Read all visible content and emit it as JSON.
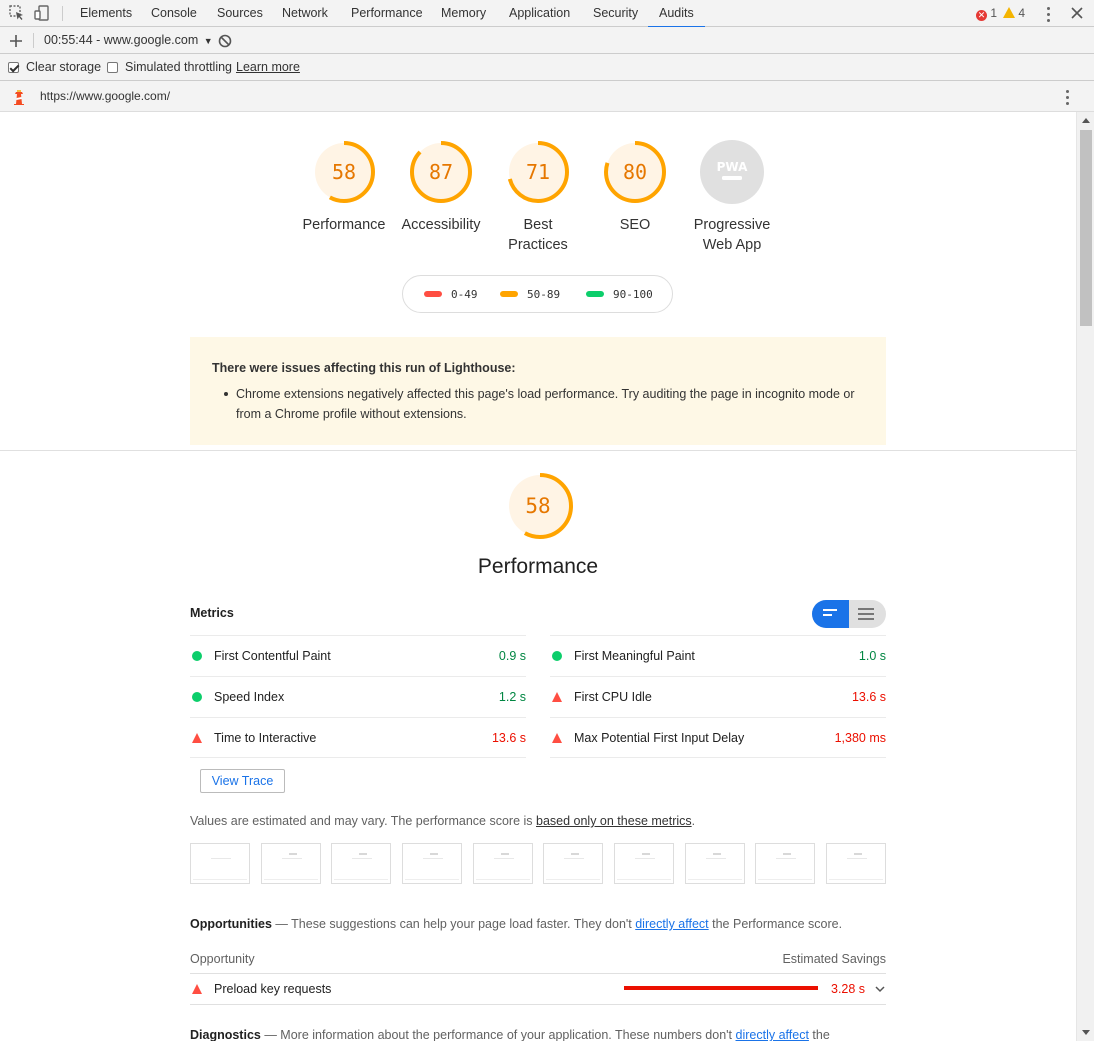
{
  "devtools": {
    "tabs": [
      "Elements",
      "Console",
      "Sources",
      "Network",
      "Performance",
      "Memory",
      "Application",
      "Security",
      "Audits"
    ],
    "active_tab": "Audits",
    "error_count": "1",
    "warning_count": "4"
  },
  "toolbar": {
    "report_selector": "00:55:44 - www.google.com",
    "clear_storage_label": "Clear storage",
    "clear_storage_checked": true,
    "simulated_throttling_label": "Simulated throttling",
    "simulated_throttling_checked": false,
    "learn_more_label": "Learn more"
  },
  "url": "https://www.google.com/",
  "scores": [
    {
      "label_line1": "Performance",
      "label_line2": "",
      "value": "58",
      "fraction": 0.58
    },
    {
      "label_line1": "Accessibility",
      "label_line2": "",
      "value": "87",
      "fraction": 0.87
    },
    {
      "label_line1": "Best",
      "label_line2": "Practices",
      "value": "71",
      "fraction": 0.71
    },
    {
      "label_line1": "SEO",
      "label_line2": "",
      "value": "80",
      "fraction": 0.8
    },
    {
      "label_line1": "Progressive",
      "label_line2": "Web App",
      "value": "PWA",
      "fraction": 0
    }
  ],
  "legend": {
    "low": "0-49",
    "mid": "50-89",
    "high": "90-100",
    "colors": {
      "low": "#ff4e42",
      "mid": "#ffa400",
      "high": "#0cce6b"
    }
  },
  "warning": {
    "title": "There were issues affecting this run of Lighthouse:",
    "item": "Chrome extensions negatively affected this page's load performance. Try auditing the page in incognito mode or from a Chrome profile without extensions."
  },
  "performance": {
    "score": "58",
    "fraction": 0.58,
    "title": "Performance",
    "metrics_heading": "Metrics",
    "metrics": [
      {
        "name": "First Contentful Paint",
        "value": "0.9 s",
        "status": "pass"
      },
      {
        "name": "First Meaningful Paint",
        "value": "1.0 s",
        "status": "pass"
      },
      {
        "name": "Speed Index",
        "value": "1.2 s",
        "status": "pass"
      },
      {
        "name": "First CPU Idle",
        "value": "13.6 s",
        "status": "fail"
      },
      {
        "name": "Time to Interactive",
        "value": "13.6 s",
        "status": "fail"
      },
      {
        "name": "Max Potential First Input Delay",
        "value": "1,380 ms",
        "status": "fail"
      }
    ],
    "view_trace_label": "View Trace",
    "estimated_text": "Values are estimated and may vary. The performance score is ",
    "estimated_link": "based only on these metrics",
    "estimated_end": "."
  },
  "opportunities": {
    "title": "Opportunities",
    "desc_start": " — These suggestions can help your page load faster. They don't ",
    "desc_link": "directly affect",
    "desc_end": " the Performance score.",
    "col_left": "Opportunity",
    "col_right": "Estimated Savings",
    "rows": [
      {
        "name": "Preload key requests",
        "savings": "3.28 s"
      }
    ]
  },
  "diagnostics": {
    "title": "Diagnostics",
    "desc_start": " — More information about the performance of your application. These numbers don't ",
    "desc_link": "directly affect",
    "desc_end": " the"
  }
}
